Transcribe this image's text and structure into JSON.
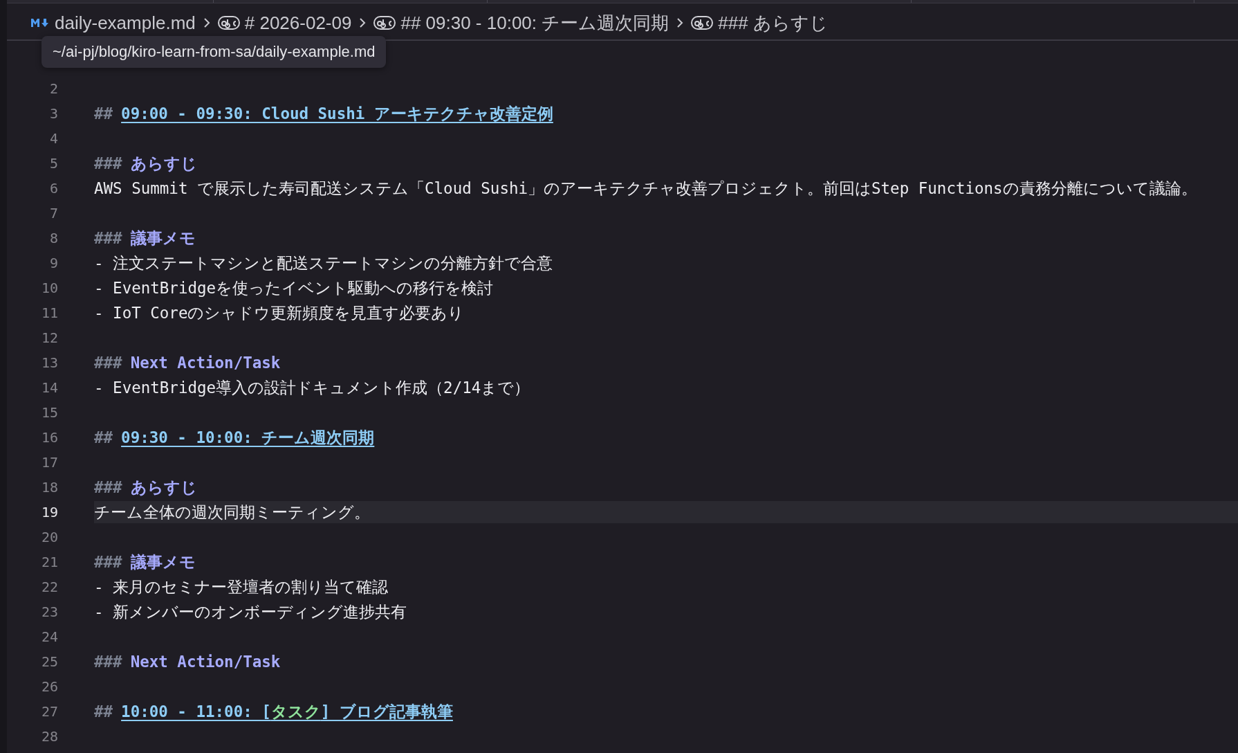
{
  "breadcrumbs": [
    {
      "kind": "file",
      "label": "daily-example.md"
    },
    {
      "kind": "heading",
      "label": "# 2026-02-09"
    },
    {
      "kind": "heading",
      "label": "## 09:30 - 10:00: チーム週次同期"
    },
    {
      "kind": "heading",
      "label": "### あらすじ"
    }
  ],
  "tooltip": "~/ai-pj/blog/kiro-learn-from-sa/daily-example.md",
  "lines": [
    {
      "n": "2",
      "kind": "blank",
      "current": false
    },
    {
      "n": "3",
      "kind": "h2",
      "marker": "##",
      "parts": [
        {
          "text": "09:00 - 09:30: Cloud Sushi アーキテクチャ改善定例",
          "kind": "plain"
        }
      ],
      "current": false
    },
    {
      "n": "4",
      "kind": "blank",
      "current": false
    },
    {
      "n": "5",
      "kind": "h3",
      "marker": "###",
      "text": "あらすじ",
      "current": false
    },
    {
      "n": "6",
      "kind": "text",
      "text": "AWS Summit で展示した寿司配送システム「Cloud Sushi」のアーキテクチャ改善プロジェクト。前回はStep Functionsの責務分離について議論。",
      "current": false
    },
    {
      "n": "7",
      "kind": "blank",
      "current": false
    },
    {
      "n": "8",
      "kind": "h3",
      "marker": "###",
      "text": "議事メモ",
      "current": false
    },
    {
      "n": "9",
      "kind": "text",
      "text": "- 注文ステートマシンと配送ステートマシンの分離方針で合意",
      "current": false
    },
    {
      "n": "10",
      "kind": "text",
      "text": "- EventBridgeを使ったイベント駆動への移行を検討",
      "current": false
    },
    {
      "n": "11",
      "kind": "text",
      "text": "- IoT Coreのシャドウ更新頻度を見直す必要あり",
      "current": false
    },
    {
      "n": "12",
      "kind": "blank",
      "current": false
    },
    {
      "n": "13",
      "kind": "h3",
      "marker": "###",
      "text": "Next Action/Task",
      "current": false
    },
    {
      "n": "14",
      "kind": "text",
      "text": "- EventBridge導入の設計ドキュメント作成（2/14まで）",
      "current": false
    },
    {
      "n": "15",
      "kind": "blank",
      "current": false
    },
    {
      "n": "16",
      "kind": "h2",
      "marker": "##",
      "parts": [
        {
          "text": "09:30 - 10:00: チーム週次同期",
          "kind": "plain"
        }
      ],
      "current": false
    },
    {
      "n": "17",
      "kind": "blank",
      "current": false
    },
    {
      "n": "18",
      "kind": "h3",
      "marker": "###",
      "text": "あらすじ",
      "current": false
    },
    {
      "n": "19",
      "kind": "text",
      "text": "チーム全体の週次同期ミーティング。",
      "current": true
    },
    {
      "n": "20",
      "kind": "blank",
      "current": false
    },
    {
      "n": "21",
      "kind": "h3",
      "marker": "###",
      "text": "議事メモ",
      "current": false
    },
    {
      "n": "22",
      "kind": "text",
      "text": "- 来月のセミナー登壇者の割り当て確認",
      "current": false
    },
    {
      "n": "23",
      "kind": "text",
      "text": "- 新メンバーのオンボーディング進捗共有",
      "current": false
    },
    {
      "n": "24",
      "kind": "blank",
      "current": false
    },
    {
      "n": "25",
      "kind": "h3",
      "marker": "###",
      "text": "Next Action/Task",
      "current": false
    },
    {
      "n": "26",
      "kind": "blank",
      "current": false
    },
    {
      "n": "27",
      "kind": "h2",
      "marker": "##",
      "parts": [
        {
          "text": "10:00 - 11:00: [",
          "kind": "plain"
        },
        {
          "text": "タスク",
          "kind": "tag"
        },
        {
          "text": "] ブログ記事執筆",
          "kind": "plain"
        }
      ],
      "current": false
    },
    {
      "n": "28",
      "kind": "blank",
      "current": false
    }
  ]
}
